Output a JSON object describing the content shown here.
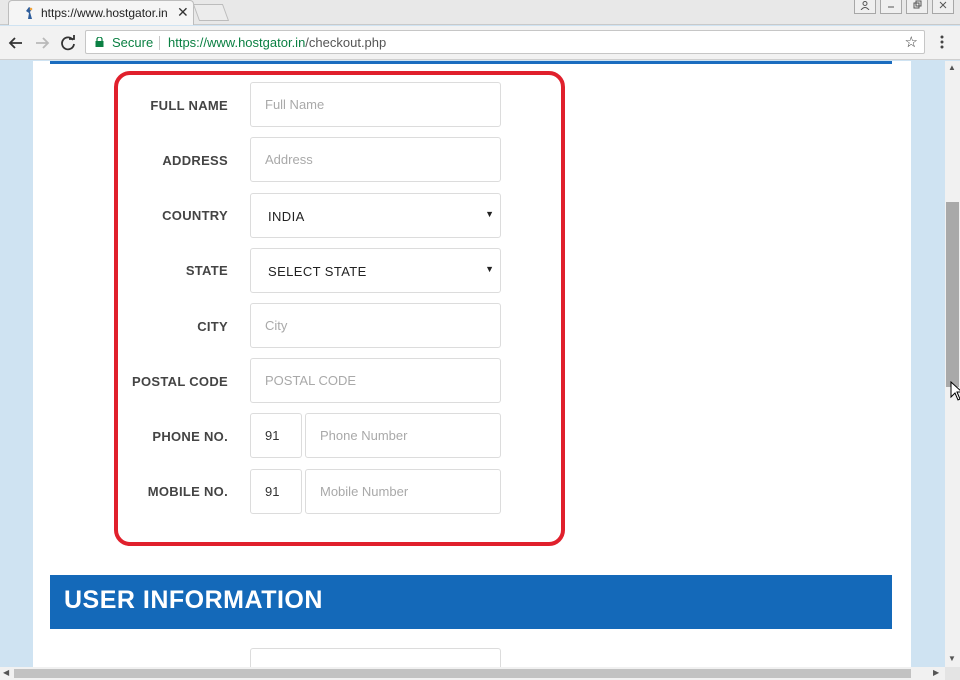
{
  "browser": {
    "tab_title": "https://www.hostgator.in",
    "close_glyph": "✕",
    "secure_label": "Secure",
    "url_origin": "https://www.hostgator.in",
    "url_path": "/checkout.php",
    "star_glyph": "☆"
  },
  "form": {
    "fields": [
      {
        "label": "FULL NAME",
        "placeholder": "Full Name"
      },
      {
        "label": "ADDRESS",
        "placeholder": "Address"
      },
      {
        "label": "COUNTRY",
        "value": "INDIA"
      },
      {
        "label": "STATE",
        "value": "SELECT STATE"
      },
      {
        "label": "CITY",
        "placeholder": "City"
      },
      {
        "label": "POSTAL CODE",
        "placeholder": "POSTAL CODE"
      },
      {
        "label": "PHONE NO.",
        "code": "91",
        "placeholder": "Phone Number"
      },
      {
        "label": "MOBILE NO.",
        "code": "91",
        "placeholder": "Mobile Number"
      }
    ],
    "caret_glyph": "▼"
  },
  "section": {
    "title": "USER INFORMATION"
  },
  "colors": {
    "accent": "#1469b9",
    "highlight": "#e0202c",
    "secure": "#0b8043"
  },
  "icons": [
    "hostgator-favicon-icon",
    "back-arrow-icon",
    "forward-arrow-icon",
    "reload-icon",
    "lock-icon",
    "star-icon",
    "menu-dots-icon",
    "caret-down-icon",
    "mouse-cursor-icon"
  ]
}
